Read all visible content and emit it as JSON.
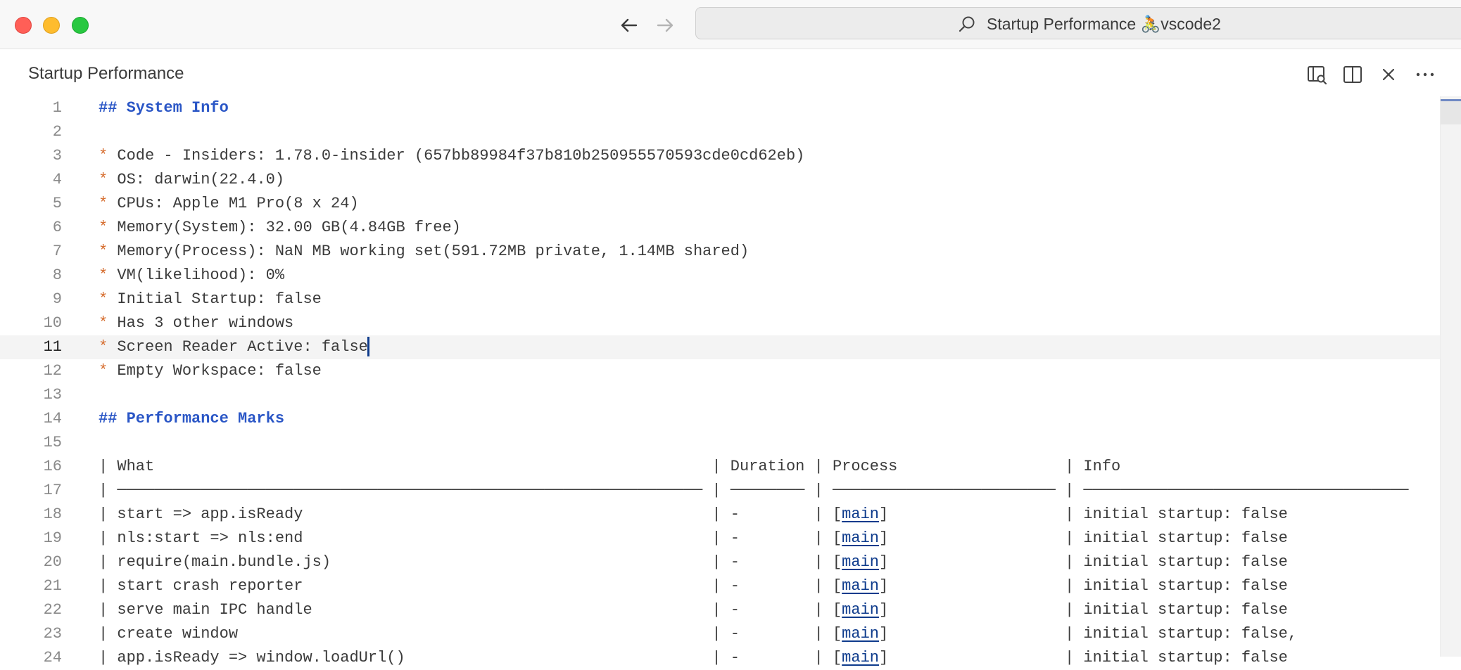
{
  "window": {
    "command_center": {
      "text": "Startup Performance 🚴vscode2"
    }
  },
  "editor": {
    "title": "Startup Performance",
    "actions": [
      "open-preview-icon",
      "split-editor-icon",
      "close-icon",
      "more-actions-icon"
    ],
    "current_line": 11,
    "lines": [
      {
        "n": "1",
        "segments": [
          {
            "t": "## System Info",
            "c": "hd"
          }
        ]
      },
      {
        "n": "2",
        "segments": []
      },
      {
        "n": "3",
        "segments": [
          {
            "t": "*",
            "c": "bl"
          },
          {
            "t": " Code - Insiders: 1.78.0-insider (657bb89984f37b810b250955570593cde0cd62eb)"
          }
        ]
      },
      {
        "n": "4",
        "segments": [
          {
            "t": "*",
            "c": "bl"
          },
          {
            "t": " OS: darwin(22.4.0)"
          }
        ]
      },
      {
        "n": "5",
        "segments": [
          {
            "t": "*",
            "c": "bl"
          },
          {
            "t": " CPUs: Apple M1 Pro(8 x 24)"
          }
        ]
      },
      {
        "n": "6",
        "segments": [
          {
            "t": "*",
            "c": "bl"
          },
          {
            "t": " Memory(System): 32.00 GB(4.84GB free)"
          }
        ]
      },
      {
        "n": "7",
        "segments": [
          {
            "t": "*",
            "c": "bl"
          },
          {
            "t": " Memory(Process): NaN MB working set(591.72MB private, 1.14MB shared)"
          }
        ]
      },
      {
        "n": "8",
        "segments": [
          {
            "t": "*",
            "c": "bl"
          },
          {
            "t": " VM(likelihood): 0%"
          }
        ]
      },
      {
        "n": "9",
        "segments": [
          {
            "t": "*",
            "c": "bl"
          },
          {
            "t": " Initial Startup: false"
          }
        ]
      },
      {
        "n": "10",
        "segments": [
          {
            "t": "*",
            "c": "bl"
          },
          {
            "t": " Has 3 other windows"
          }
        ]
      },
      {
        "n": "11",
        "segments": [
          {
            "t": "*",
            "c": "bl"
          },
          {
            "t": " Screen Reader Active: false"
          }
        ]
      },
      {
        "n": "12",
        "segments": [
          {
            "t": "*",
            "c": "bl"
          },
          {
            "t": " Empty Workspace: false"
          }
        ]
      },
      {
        "n": "13",
        "segments": []
      },
      {
        "n": "14",
        "segments": [
          {
            "t": "## Performance Marks",
            "c": "hd"
          }
        ]
      },
      {
        "n": "15",
        "segments": []
      },
      {
        "n": "16",
        "segments": [
          {
            "t": "| What                                                            | Duration | Process                  | Info"
          }
        ]
      },
      {
        "n": "17",
        "segments": [
          {
            "t": "| ─────────────────────────────────────────────────────────────── | ──────── | ──────────────────────── | ───────────────────────────────────"
          }
        ]
      },
      {
        "n": "18",
        "segments": [
          {
            "t": "| start => app.isReady                                            | -        | ["
          },
          {
            "t": "main",
            "c": "lk"
          },
          {
            "t": "]                   | initial startup: false"
          }
        ]
      },
      {
        "n": "19",
        "segments": [
          {
            "t": "| nls:start => nls:end                                            | -        | ["
          },
          {
            "t": "main",
            "c": "lk"
          },
          {
            "t": "]                   | initial startup: false"
          }
        ]
      },
      {
        "n": "20",
        "segments": [
          {
            "t": "| require(main.bundle.js)                                         | -        | ["
          },
          {
            "t": "main",
            "c": "lk"
          },
          {
            "t": "]                   | initial startup: false"
          }
        ]
      },
      {
        "n": "21",
        "segments": [
          {
            "t": "| start crash reporter                                            | -        | ["
          },
          {
            "t": "main",
            "c": "lk"
          },
          {
            "t": "]                   | initial startup: false"
          }
        ]
      },
      {
        "n": "22",
        "segments": [
          {
            "t": "| serve main IPC handle                                           | -        | ["
          },
          {
            "t": "main",
            "c": "lk"
          },
          {
            "t": "]                   | initial startup: false"
          }
        ]
      },
      {
        "n": "23",
        "segments": [
          {
            "t": "| create window                                                   | -        | ["
          },
          {
            "t": "main",
            "c": "lk"
          },
          {
            "t": "]                   | initial startup: false,"
          }
        ]
      },
      {
        "n": "24",
        "segments": [
          {
            "t": "| app.isReady => window.loadUrl()                                 | -        | ["
          },
          {
            "t": "main",
            "c": "lk"
          },
          {
            "t": "]                   | initial startup: false"
          }
        ]
      }
    ]
  }
}
